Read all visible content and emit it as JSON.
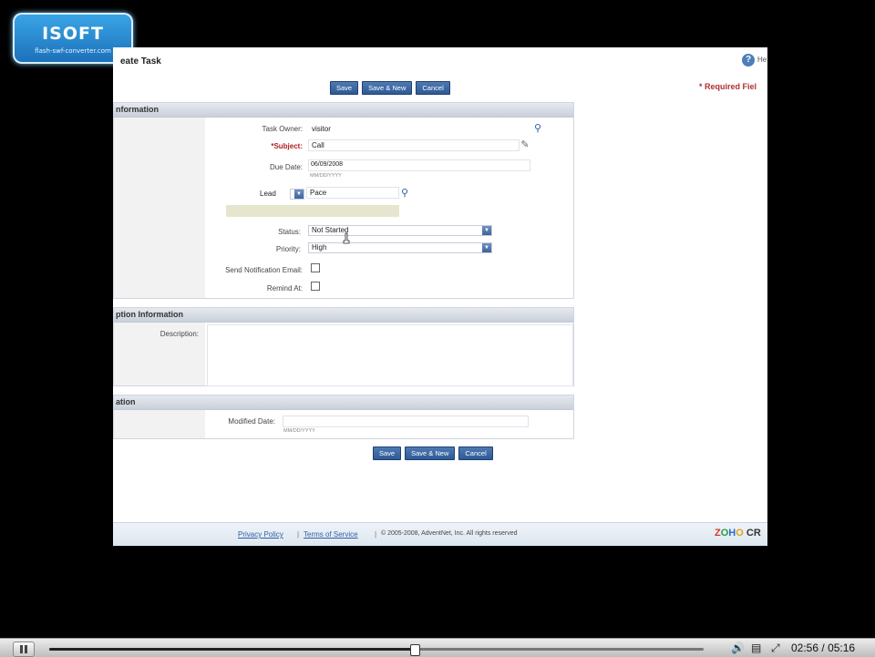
{
  "watermark": {
    "brand": "ISOFT",
    "url": "flash-swf-converter.com"
  },
  "form": {
    "title": "eate Task",
    "help_label": "He",
    "required_note": "* Required Fiel",
    "buttons": {
      "save": "Save",
      "save_new": "Save & New",
      "cancel": "Cancel"
    },
    "sections": {
      "task_info": "nformation",
      "description_info": "ption Information",
      "other_info": "ation"
    },
    "fields": {
      "task_owner": {
        "label": "Task Owner:",
        "value": "visitor"
      },
      "subject": {
        "label": "Subject:",
        "value": "Call"
      },
      "due_date": {
        "label": "Due Date:",
        "value": "06/09/2008",
        "hint": "MM/DD/YYYY"
      },
      "lead": {
        "type": "Lead",
        "value": "Pace"
      },
      "status": {
        "label": "Status:",
        "value": "Not Started"
      },
      "priority": {
        "label": "Priority:",
        "value": "High"
      },
      "send_notification": {
        "label": "Send Notification Email:",
        "checked": false
      },
      "remind_at": {
        "label": "Remind At:",
        "checked": false
      },
      "description": {
        "label": "Description:"
      },
      "modified_date": {
        "label": "Modified Date:",
        "hint": "MM/DD/YYYY"
      }
    },
    "footer": {
      "privacy": "Privacy Policy",
      "separator": "|",
      "terms": "Terms of Service",
      "copyright": "© 2005-2008, AdventNet, Inc. All rights reserved",
      "logo": [
        "Z",
        "O",
        "H",
        "O",
        " CR"
      ]
    }
  },
  "player": {
    "elapsed": "02:56",
    "total": "05:16",
    "separator": "/",
    "progress": 0.557
  },
  "colors": {
    "accent": "#2e5a95",
    "required": "#b03030",
    "link": "#3060a8"
  }
}
